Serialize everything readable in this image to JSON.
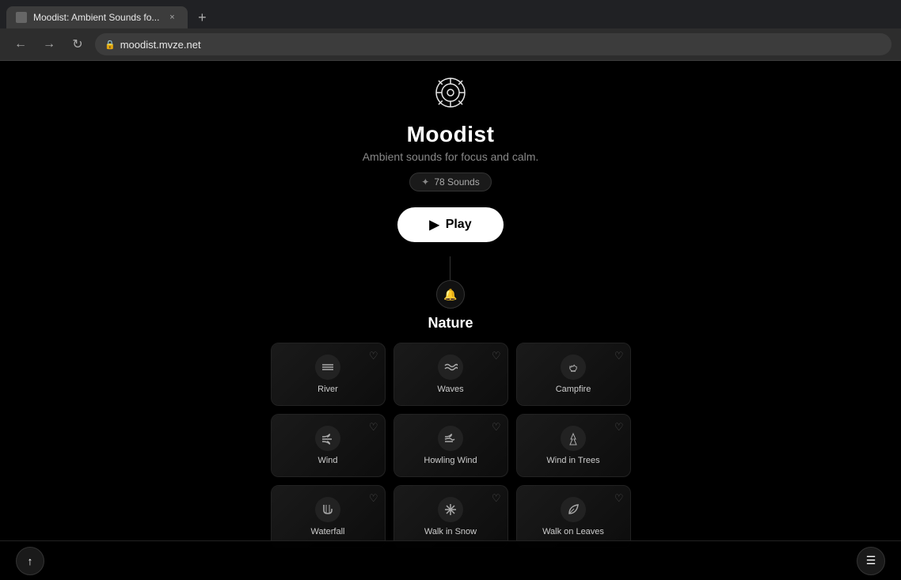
{
  "browser": {
    "tab_title": "Moodist: Ambient Sounds fo...",
    "tab_close": "×",
    "new_tab": "+",
    "back": "←",
    "forward": "→",
    "refresh": "↻",
    "address_icon": "🔒",
    "address_url": "moodist.mvze.net"
  },
  "header": {
    "logo_icon": "✿",
    "title": "Moodist",
    "subtitle": "Ambient sounds for focus and calm.",
    "badge_icon": "✦",
    "badge_text": "78 Sounds",
    "play_icon": "▶",
    "play_label": "Play"
  },
  "nature_section": {
    "section_icon": "🔔",
    "section_title": "Nature"
  },
  "sounds": [
    {
      "id": "river",
      "name": "River",
      "icon": "≡≡"
    },
    {
      "id": "waves",
      "name": "Waves",
      "icon": "≋"
    },
    {
      "id": "campfire",
      "name": "Campfire",
      "icon": "🔥"
    },
    {
      "id": "wind",
      "name": "Wind",
      "icon": "≈"
    },
    {
      "id": "howling-wind",
      "name": "Howling Wind",
      "icon": "≋≈"
    },
    {
      "id": "wind-in-trees",
      "name": "Wind in Trees",
      "icon": "🌲"
    },
    {
      "id": "waterfall",
      "name": "Waterfall",
      "icon": "🏔"
    },
    {
      "id": "walk-in-snow",
      "name": "Walk in Snow",
      "icon": "❄"
    },
    {
      "id": "walk-on-leaves",
      "name": "Walk on Leaves",
      "icon": "🍃"
    }
  ],
  "bottom": {
    "scroll_up_icon": "↑",
    "menu_icon": "☰"
  }
}
